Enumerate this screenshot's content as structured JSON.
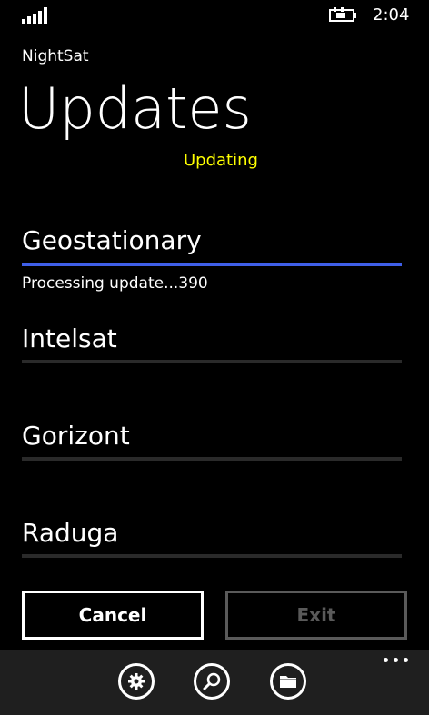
{
  "status_bar": {
    "time": "2:04",
    "signal_icon": "signal-bars-icon",
    "battery_icon": "battery-charging-icon"
  },
  "header": {
    "app_name": "NightSat",
    "page_title": "Updates",
    "status": "Updating",
    "status_color": "#ffff00"
  },
  "satellites": [
    {
      "name": "Geostationary",
      "detail": "Processing update...390",
      "progress": 1.0,
      "active": true
    },
    {
      "name": "Intelsat",
      "detail": "",
      "progress": 0,
      "active": false
    },
    {
      "name": "Gorizont",
      "detail": "",
      "progress": 0,
      "active": false
    },
    {
      "name": "Raduga",
      "detail": "",
      "progress": 0,
      "active": false
    }
  ],
  "buttons": {
    "cancel": "Cancel",
    "exit": "Exit"
  },
  "app_bar": {
    "icons": [
      "settings-icon",
      "search-icon",
      "folder-icon"
    ],
    "more_icon": "more-ellipsis-icon"
  },
  "colors": {
    "accent": "#3f5fe8",
    "track": "#2a2a2a",
    "disabled": "#5a5a5a",
    "app_bar_bg": "#1f1f1f"
  }
}
